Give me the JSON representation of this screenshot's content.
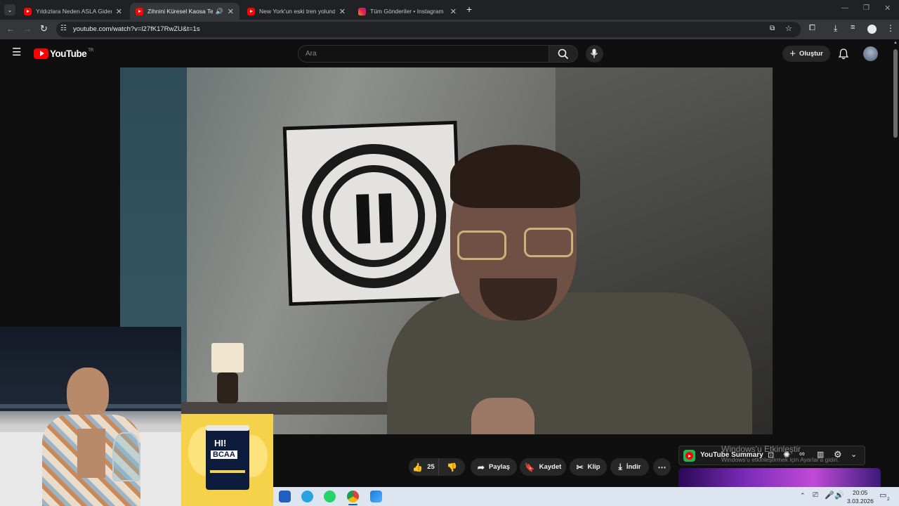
{
  "browser": {
    "tabs": [
      {
        "title": "Yıldızlara Neden ASLA Gidemey",
        "favicon": "youtube-icon",
        "active": false
      },
      {
        "title": "Zihnini Küresel Kaosa Teslim",
        "favicon": "youtube-icon",
        "active": true,
        "audio": true
      },
      {
        "title": "New York'un eski tren yolunda",
        "favicon": "youtube-icon",
        "active": false
      },
      {
        "title": "Tüm Gönderiler • Instagram",
        "favicon": "instagram-icon",
        "active": false
      }
    ],
    "url": "youtube.com/watch?v=l27fK17RwZU&t=1s"
  },
  "youtube": {
    "logo_text": "YouTube",
    "region": "TR",
    "search_placeholder": "Ara",
    "create_label": "Oluştur",
    "actions": {
      "like_count": "25",
      "share": "Paylaş",
      "save": "Kaydet",
      "clip": "Klip",
      "download": "İndir"
    }
  },
  "extension": {
    "title": "YouTube Summary",
    "watermark_line1": "Windows'u Etkinleştir",
    "watermark_line2": "Windows'u etkinleştirmek için Ayarlar'a gidin."
  },
  "ad": {
    "brand": "HI!",
    "product": "BCAA"
  },
  "taskbar": {
    "time": "20:05",
    "date": "3.03.2026",
    "notif_count": "2"
  },
  "colors": {
    "yt_red": "#ff0000",
    "chrome_dark": "#202124",
    "yt_bg": "#0f0f0f",
    "pill_bg": "#272727",
    "ad_yellow": "#f6d24a"
  }
}
